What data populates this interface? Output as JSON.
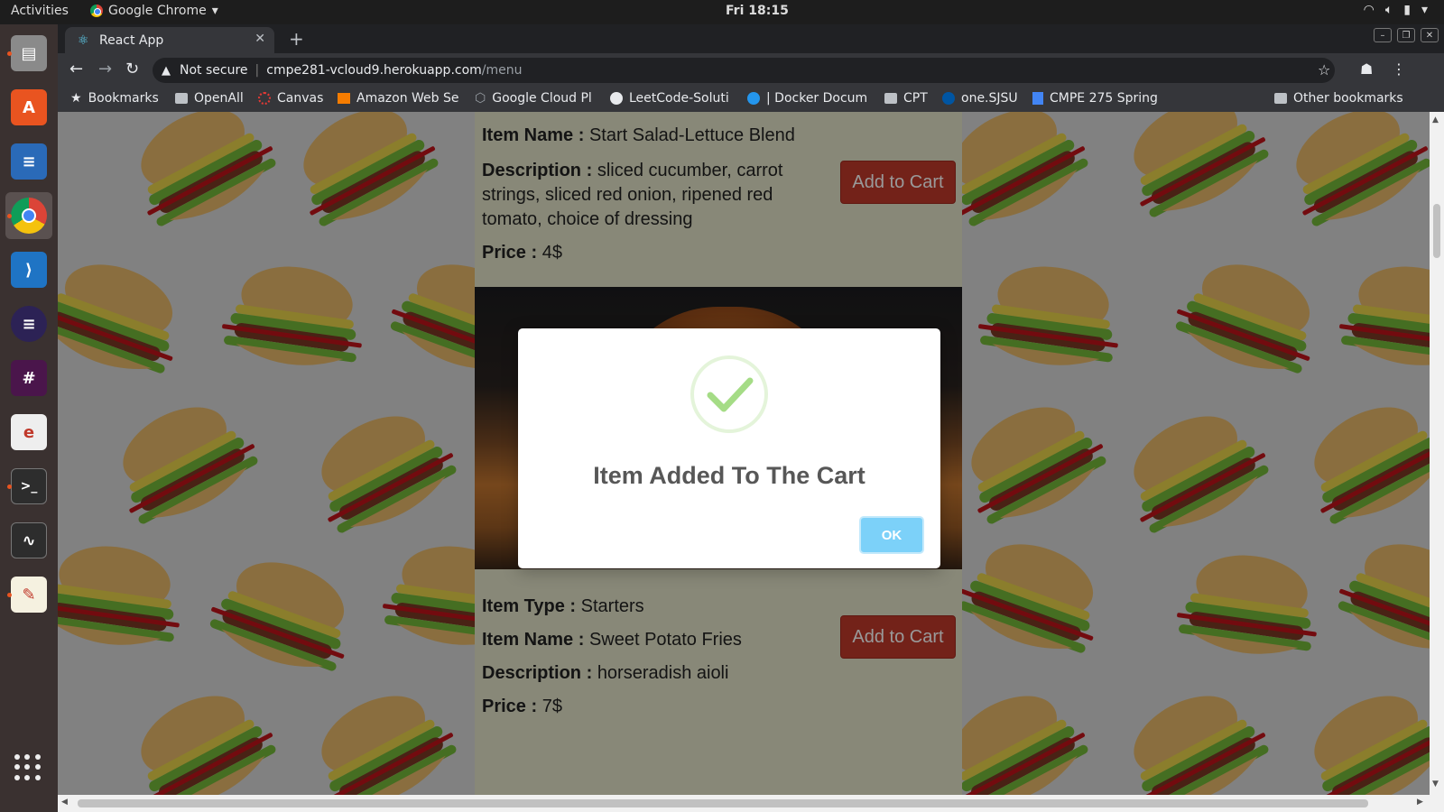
{
  "topbar": {
    "activities": "Activities",
    "app_name": "Google Chrome",
    "clock": "Fri 18:15"
  },
  "tab": {
    "title": "React App"
  },
  "omnibox": {
    "security": "Not secure",
    "host": "cmpe281-vcloud9.herokuapp.com",
    "path": "/menu"
  },
  "bookmarks": {
    "items": [
      {
        "label": "Bookmarks",
        "icon": "star-icon"
      },
      {
        "label": "OpenAll",
        "icon": "folder-icon"
      },
      {
        "label": "Canvas",
        "icon": "canvas-icon"
      },
      {
        "label": "Amazon Web Se",
        "icon": "aws-icon"
      },
      {
        "label": "Google Cloud Pl",
        "icon": "gcp-icon"
      },
      {
        "label": "LeetCode-Soluti",
        "icon": "github-icon"
      },
      {
        "label": "| Docker Docum",
        "icon": "docker-icon"
      },
      {
        "label": "CPT",
        "icon": "folder-icon"
      },
      {
        "label": "one.SJSU",
        "icon": "sjsu-icon"
      },
      {
        "label": "CMPE 275 Spring",
        "icon": "doc-icon"
      }
    ],
    "other": "Other bookmarks"
  },
  "menu_items": [
    {
      "item_name_label": "Item Name :",
      "item_name": "Start Salad-Lettuce Blend",
      "description_label": "Description :",
      "description": "sliced cucumber, carrot strings, sliced red onion, ripened red tomato, choice of dressing",
      "price_label": "Price :",
      "price": "4$",
      "button": "Add to Cart"
    },
    {
      "item_type_label": "Item Type :",
      "item_type": "Starters",
      "item_name_label": "Item Name :",
      "item_name": "Sweet Potato Fries",
      "description_label": "Description :",
      "description": "horseradish aioli",
      "price_label": "Price :",
      "price": "7$",
      "button": "Add to Cart"
    }
  ],
  "modal": {
    "title": "Item Added To The Cart",
    "ok": "OK",
    "icon": "success-check-icon"
  },
  "colors": {
    "add_to_cart": "#c0392b",
    "ok_button": "#7cd1f9",
    "success_check": "#a5dc86"
  }
}
